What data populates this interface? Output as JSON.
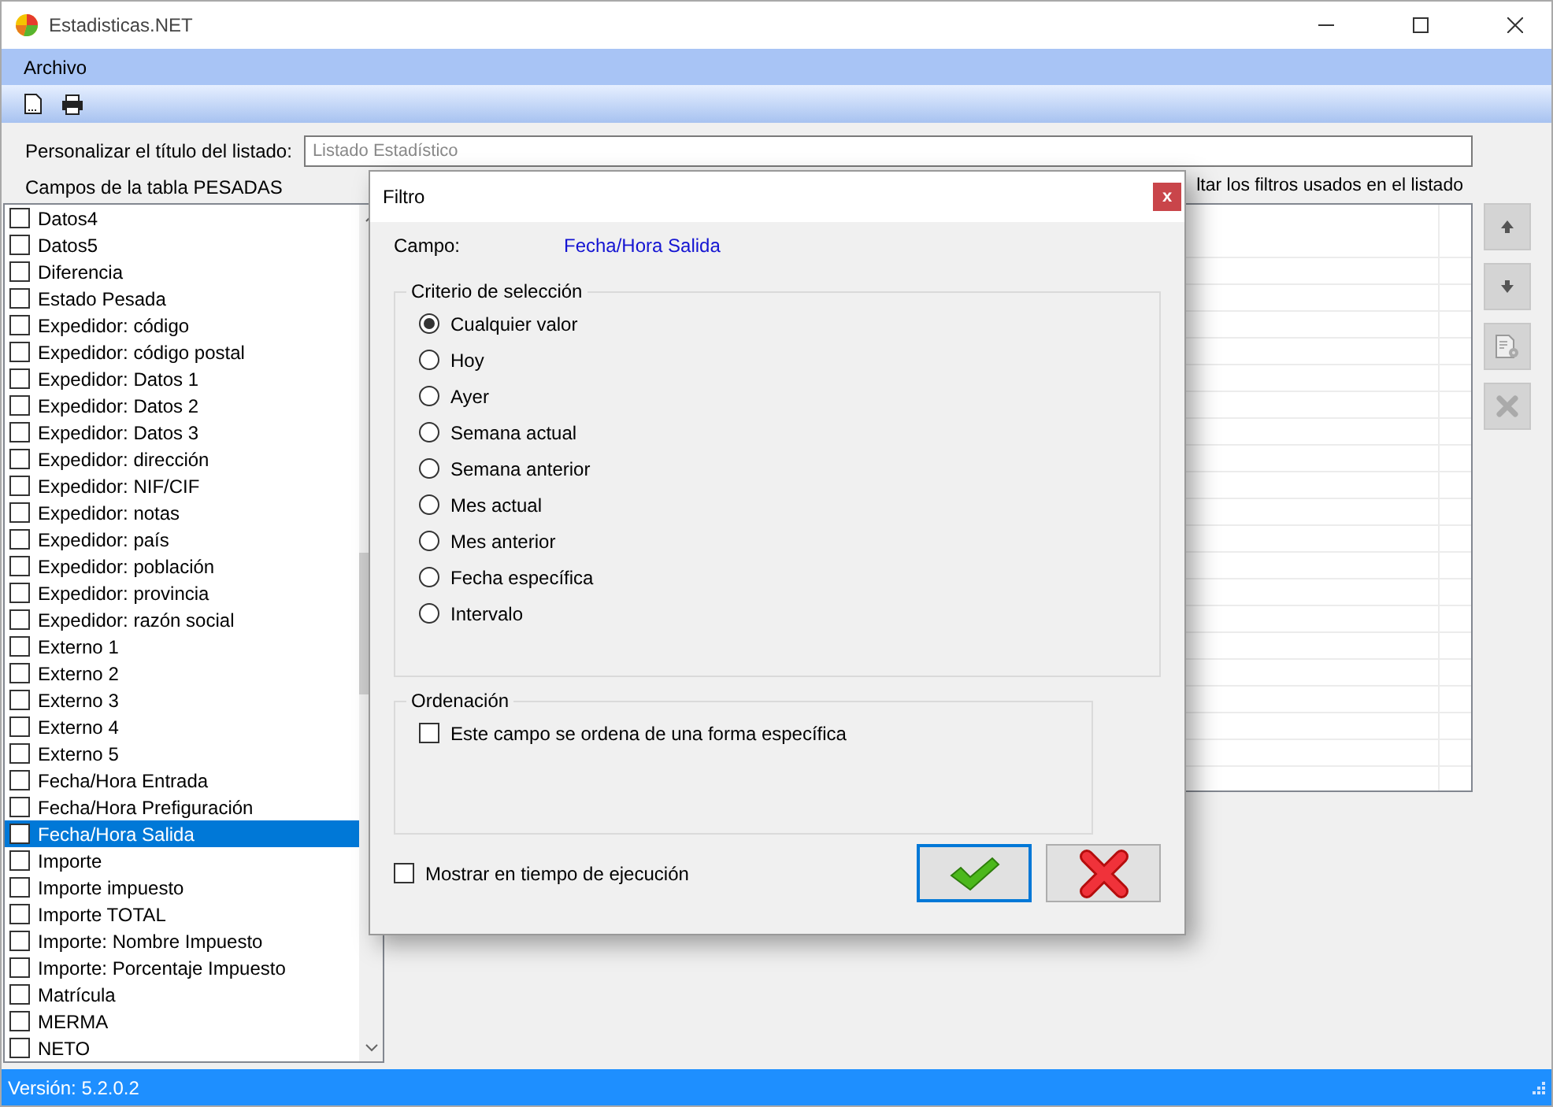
{
  "window": {
    "title": "Estadisticas.NET"
  },
  "menu": [
    "Archivo"
  ],
  "title_field": {
    "label": "Personalizar el título del listado:",
    "placeholder": "Listado Estadístico"
  },
  "fields_label": "Campos de la tabla PESADAS",
  "filters_label": "ltar los filtros usados en el listado",
  "fields": [
    {
      "label": "Datos4",
      "checked": false,
      "selected": false
    },
    {
      "label": "Datos5",
      "checked": false,
      "selected": false
    },
    {
      "label": "Diferencia",
      "checked": false,
      "selected": false
    },
    {
      "label": "Estado Pesada",
      "checked": false,
      "selected": false
    },
    {
      "label": "Expedidor: código",
      "checked": false,
      "selected": false
    },
    {
      "label": "Expedidor: código postal",
      "checked": false,
      "selected": false
    },
    {
      "label": "Expedidor: Datos 1",
      "checked": false,
      "selected": false
    },
    {
      "label": "Expedidor: Datos 2",
      "checked": false,
      "selected": false
    },
    {
      "label": "Expedidor: Datos 3",
      "checked": false,
      "selected": false
    },
    {
      "label": "Expedidor: dirección",
      "checked": false,
      "selected": false
    },
    {
      "label": "Expedidor: NIF/CIF",
      "checked": false,
      "selected": false
    },
    {
      "label": "Expedidor: notas",
      "checked": false,
      "selected": false
    },
    {
      "label": "Expedidor: país",
      "checked": false,
      "selected": false
    },
    {
      "label": "Expedidor: población",
      "checked": false,
      "selected": false
    },
    {
      "label": "Expedidor: provincia",
      "checked": false,
      "selected": false
    },
    {
      "label": "Expedidor: razón social",
      "checked": false,
      "selected": false
    },
    {
      "label": "Externo 1",
      "checked": false,
      "selected": false
    },
    {
      "label": "Externo 2",
      "checked": false,
      "selected": false
    },
    {
      "label": "Externo 3",
      "checked": false,
      "selected": false
    },
    {
      "label": "Externo 4",
      "checked": false,
      "selected": false
    },
    {
      "label": "Externo 5",
      "checked": false,
      "selected": false
    },
    {
      "label": "Fecha/Hora Entrada",
      "checked": false,
      "selected": false
    },
    {
      "label": "Fecha/Hora Prefiguración",
      "checked": false,
      "selected": false
    },
    {
      "label": "Fecha/Hora Salida",
      "checked": false,
      "selected": true
    },
    {
      "label": "Importe",
      "checked": false,
      "selected": false
    },
    {
      "label": "Importe impuesto",
      "checked": false,
      "selected": false
    },
    {
      "label": "Importe TOTAL",
      "checked": false,
      "selected": false
    },
    {
      "label": "Importe: Nombre Impuesto",
      "checked": false,
      "selected": false
    },
    {
      "label": "Importe: Porcentaje Impuesto",
      "checked": false,
      "selected": false
    },
    {
      "label": "Matrícula",
      "checked": false,
      "selected": false
    },
    {
      "label": "MERMA",
      "checked": false,
      "selected": false
    },
    {
      "label": "NETO",
      "checked": false,
      "selected": false
    }
  ],
  "dialog": {
    "title": "Filtro",
    "close": "x",
    "field_label": "Campo:",
    "field_value": "Fecha/Hora Salida",
    "criteria_title": "Criterio de selección",
    "criteria": [
      {
        "label": "Cualquier valor",
        "selected": true
      },
      {
        "label": "Hoy",
        "selected": false
      },
      {
        "label": "Ayer",
        "selected": false
      },
      {
        "label": "Semana actual",
        "selected": false
      },
      {
        "label": "Semana anterior",
        "selected": false
      },
      {
        "label": "Mes actual",
        "selected": false
      },
      {
        "label": "Mes anterior",
        "selected": false
      },
      {
        "label": "Fecha específica",
        "selected": false
      },
      {
        "label": "Intervalo",
        "selected": false
      }
    ],
    "order_title": "Ordenación",
    "order_option": {
      "label": "Este campo se ordena de una forma específica",
      "checked": false
    },
    "runtime_option": {
      "label": "Mostrar en tiempo de ejecución",
      "checked": false
    }
  },
  "status_bar": "Versión: 5.2.0.2"
}
